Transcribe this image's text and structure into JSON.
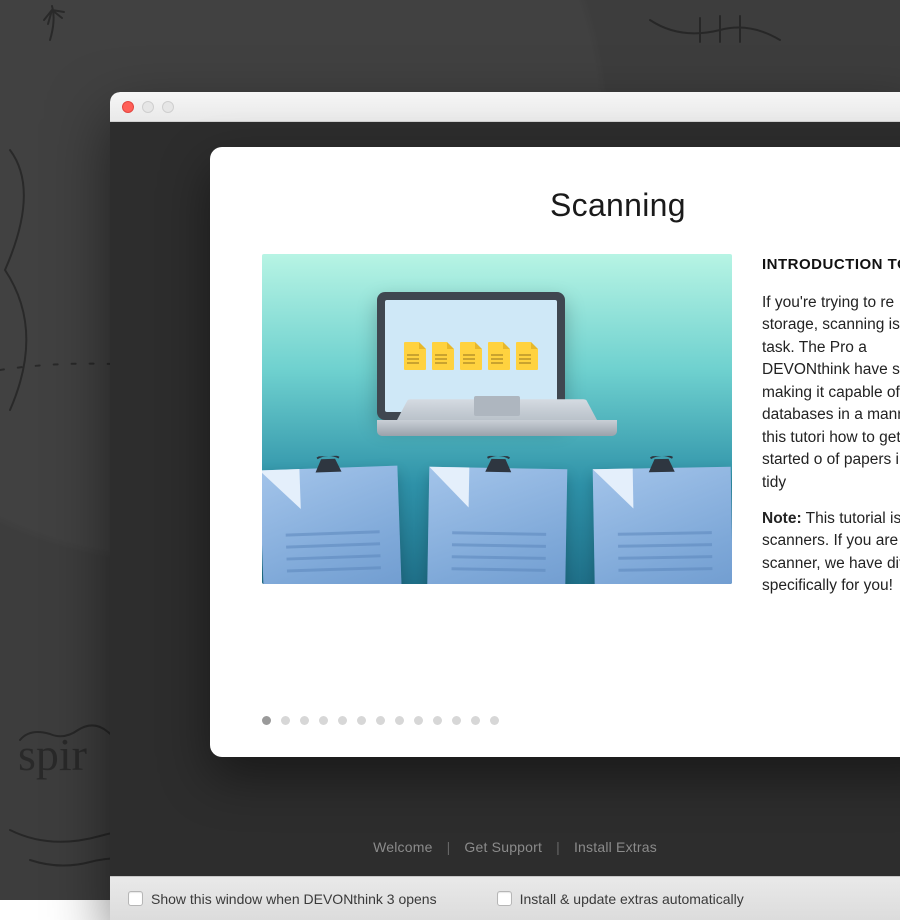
{
  "page_title": "Scanning",
  "section_heading": "INTRODUCTION TO",
  "paragraph1": "If you're trying to re​ storage, scanning is ​that task. The Pro a​ DEVONthink have sc​ making it capable of ​your databases in a ​manner. In this tutori​ how to get started o​ of papers into a tidy",
  "note_label": "Note:",
  "note_body": " This tutorial is​ scanners. If you are ​scanner, we have dif​ specifically for you!",
  "back_links": {
    "welcome": "Welcome",
    "support": "Get Support",
    "extras": "Install Extras"
  },
  "footer": {
    "show_on_open": "Show this window when DEVONthink 3 opens",
    "auto_update": "Install & update extras automatically"
  },
  "dots_total": 13,
  "dots_active_index": 0
}
